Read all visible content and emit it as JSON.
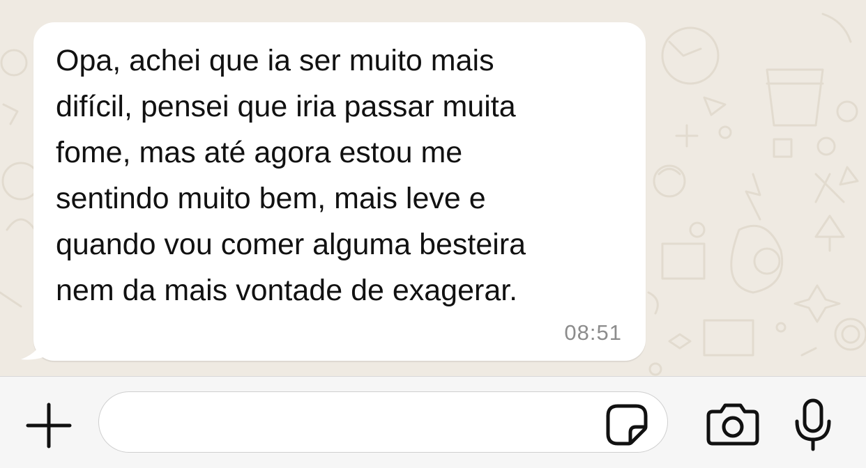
{
  "message": {
    "text": "Opa, achei que ia ser muito mais\ndifícil, pensei que iria passar muita\nfome, mas até agora estou me\nsentindo muito bem, mais leve e\nquando vou comer alguma besteira\nnem da mais vontade de exagerar.",
    "time": "08:51",
    "direction": "incoming"
  },
  "composer": {
    "value": "",
    "placeholder": ""
  },
  "icons": {
    "attach": "plus-icon",
    "sticker": "sticker-icon",
    "camera": "camera-icon",
    "mic": "microphone-icon"
  },
  "colors": {
    "chat_background": "#efeae2",
    "bubble": "#ffffff",
    "timestamp": "#8c8c8c",
    "input_bar": "#f6f6f6"
  }
}
